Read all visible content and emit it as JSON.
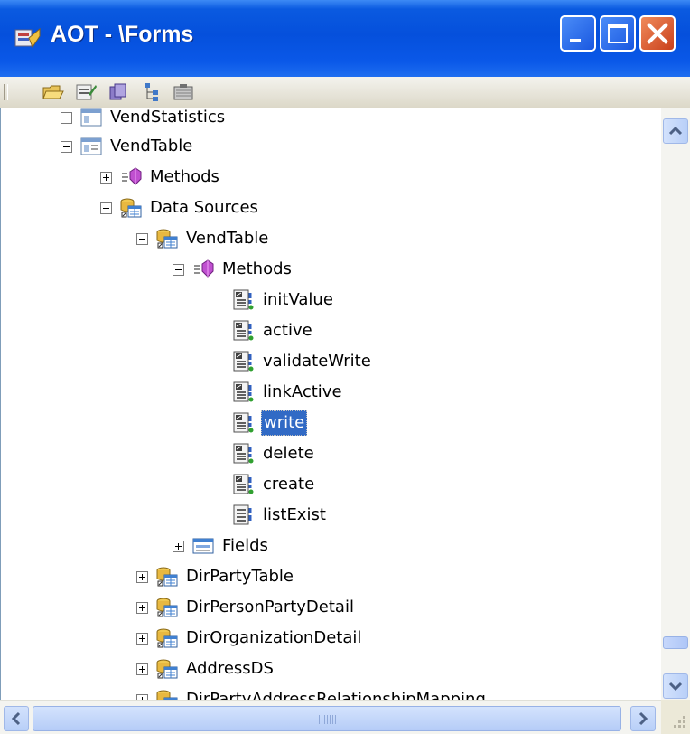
{
  "window": {
    "title": "AOT - \\Forms"
  },
  "toolbar": {
    "icons": [
      "open-folder-icon",
      "properties-icon",
      "compile-icon",
      "tree-nodes-icon",
      "save-icon"
    ]
  },
  "tree": {
    "nodes": [
      {
        "label": "VendStatistics",
        "icon": "form-icon",
        "expander": "minus",
        "level": 1,
        "state": "partially-visible"
      },
      {
        "label": "VendTable",
        "icon": "form-icon",
        "expander": "minus",
        "level": 1
      },
      {
        "label": "Methods",
        "icon": "methods-icon",
        "expander": "plus",
        "level": 2
      },
      {
        "label": "Data Sources",
        "icon": "datasources-icon",
        "expander": "minus",
        "level": 2
      },
      {
        "label": "VendTable",
        "icon": "datasource-icon",
        "expander": "minus",
        "level": 3
      },
      {
        "label": "Methods",
        "icon": "methods-icon",
        "expander": "minus",
        "level": 4
      },
      {
        "label": "initValue",
        "icon": "method-override-icon",
        "level": 5
      },
      {
        "label": "active",
        "icon": "method-override-icon",
        "level": 5
      },
      {
        "label": "validateWrite",
        "icon": "method-override-icon",
        "level": 5
      },
      {
        "label": "linkActive",
        "icon": "method-override-icon",
        "level": 5
      },
      {
        "label": "write",
        "icon": "method-override-icon",
        "level": 5,
        "selected": true
      },
      {
        "label": "delete",
        "icon": "method-override-icon",
        "level": 5
      },
      {
        "label": "create",
        "icon": "method-override-icon",
        "level": 5
      },
      {
        "label": "listExist",
        "icon": "method-icon",
        "level": 5
      },
      {
        "label": "Fields",
        "icon": "fields-icon",
        "expander": "plus",
        "level": 4
      },
      {
        "label": "DirPartyTable",
        "icon": "datasource-icon",
        "expander": "plus",
        "level": 3
      },
      {
        "label": "DirPersonPartyDetail",
        "icon": "datasource-icon",
        "expander": "plus",
        "level": 3
      },
      {
        "label": "DirOrganizationDetail",
        "icon": "datasource-icon",
        "expander": "plus",
        "level": 3
      },
      {
        "label": "AddressDS",
        "icon": "datasource-icon",
        "expander": "plus",
        "level": 3
      },
      {
        "label": "DirPartyAddressRelationshipMapping",
        "icon": "datasource-icon",
        "expander": "plus",
        "level": 3,
        "state": "partially-visible"
      }
    ]
  },
  "colors": {
    "titlebar": "#0550dc",
    "selection": "#316ac5",
    "close_button": "#c9401c",
    "tree_background": "#ffffff"
  }
}
